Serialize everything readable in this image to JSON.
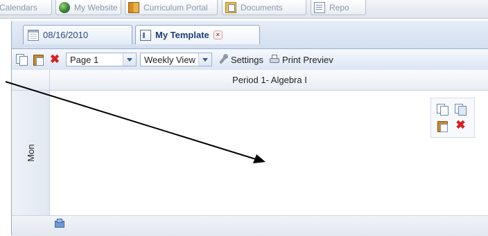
{
  "topnav": {
    "tabs": [
      {
        "label": "Calendars",
        "icon": "calendar-icon"
      },
      {
        "label": "My Website",
        "icon": "globe-icon"
      },
      {
        "label": "Curriculum Portal",
        "icon": "book-icon"
      },
      {
        "label": "Documents",
        "icon": "documents-icon"
      },
      {
        "label": "Repo",
        "icon": "report-icon"
      }
    ]
  },
  "doc_tabs": [
    {
      "label": "08/16/2010",
      "icon": "calendar-icon",
      "active": false
    },
    {
      "label": "My Template",
      "icon": "template-icon",
      "active": true,
      "close_glyph": "×"
    }
  ],
  "toolbar": {
    "copy_icon": "copy-icon",
    "paste_icon": "paste-icon",
    "delete_glyph": "✖",
    "page_select": "Page 1",
    "view_select": "Weekly View",
    "settings_label": "Settings",
    "print_preview_label": "Print Previev"
  },
  "grid": {
    "period_label": "Period 1- Algebra I",
    "day_label": "Mon",
    "cell_delete_glyph": "✖"
  },
  "colors": {
    "accent": "#dfe8f6",
    "delete_red": "#d82020",
    "arrow": "#000000"
  }
}
